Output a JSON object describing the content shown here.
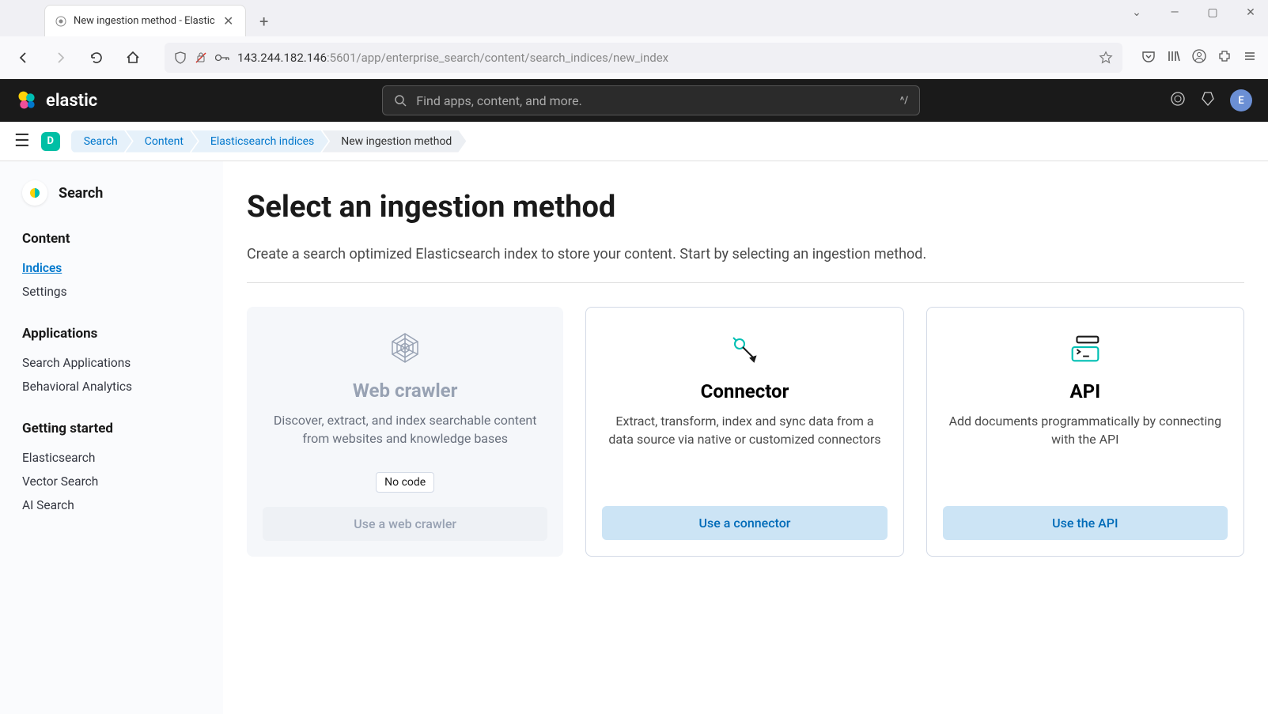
{
  "browser": {
    "tab_title": "New ingestion method - Elastic",
    "url_host": "143.244.182.146",
    "url_rest": ":5601/app/enterprise_search/content/search_indices/new_index"
  },
  "header": {
    "logo_text": "elastic",
    "search_placeholder": "Find apps, content, and more.",
    "kbd_hint": "^/",
    "avatar": "E"
  },
  "breadcrumb": {
    "space": "D",
    "items": [
      "Search",
      "Content",
      "Elasticsearch indices",
      "New ingestion method"
    ]
  },
  "sidebar": {
    "app_label": "Search",
    "sections": [
      {
        "heading": "Content",
        "items": [
          {
            "label": "Indices",
            "active": true
          },
          {
            "label": "Settings"
          }
        ]
      },
      {
        "heading": "Applications",
        "items": [
          {
            "label": "Search Applications"
          },
          {
            "label": "Behavioral Analytics"
          }
        ]
      },
      {
        "heading": "Getting started",
        "items": [
          {
            "label": "Elasticsearch"
          },
          {
            "label": "Vector Search"
          },
          {
            "label": "AI Search"
          }
        ]
      }
    ]
  },
  "page": {
    "title": "Select an ingestion method",
    "description": "Create a search optimized Elasticsearch index to store your content. Start by selecting an ingestion method."
  },
  "cards": [
    {
      "title": "Web crawler",
      "desc": "Discover, extract, and index searchable content from websites and knowledge bases",
      "badge": "No code",
      "button": "Use a web crawler",
      "disabled": true
    },
    {
      "title": "Connector",
      "desc": "Extract, transform, index and sync data from a data source via native or customized connectors",
      "button": "Use a connector",
      "disabled": false
    },
    {
      "title": "API",
      "desc": "Add documents programmatically by connecting with the API",
      "button": "Use the API",
      "disabled": false
    }
  ]
}
